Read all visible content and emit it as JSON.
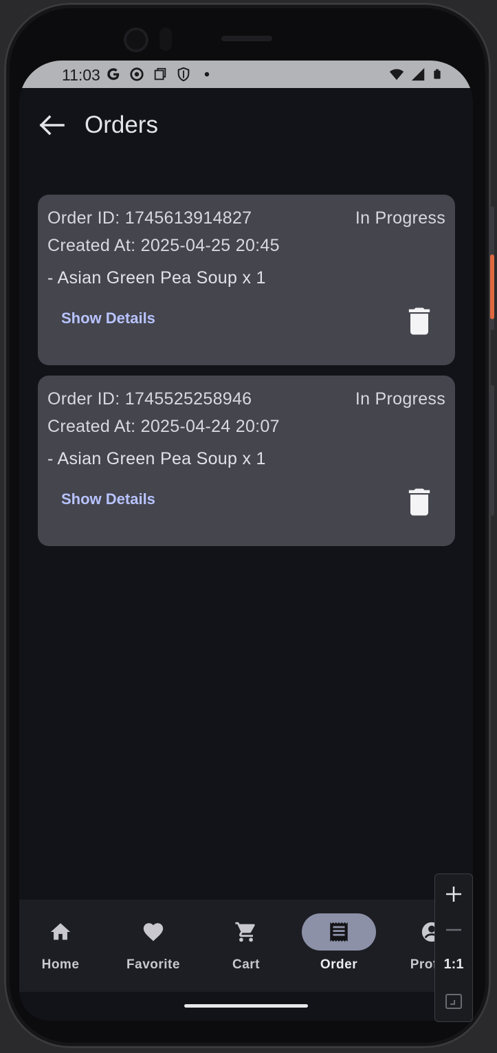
{
  "status_bar": {
    "time": "11:03"
  },
  "app_bar": {
    "title": "Orders"
  },
  "orders": [
    {
      "id_label": "Order ID: 1745613914827",
      "status": "In Progress",
      "created": "Created At: 2025-04-25 20:45",
      "item": "- Asian Green Pea Soup x 1",
      "show_details": "Show Details"
    },
    {
      "id_label": "Order ID: 1745525258946",
      "status": "In Progress",
      "created": "Created At: 2025-04-24 20:07",
      "item": "- Asian Green Pea Soup x 1",
      "show_details": "Show Details"
    }
  ],
  "nav": {
    "items": [
      {
        "label": "Home",
        "icon": "home-icon"
      },
      {
        "label": "Favorite",
        "icon": "heart-icon"
      },
      {
        "label": "Cart",
        "icon": "cart-icon"
      },
      {
        "label": "Order",
        "icon": "receipt-icon",
        "active": true
      },
      {
        "label": "Profile",
        "icon": "account-icon"
      }
    ]
  },
  "zoom": {
    "label": "1:1"
  },
  "colors": {
    "background": "#121318",
    "card": "#44454d",
    "accent_text": "#b8c3ff",
    "active_pill": "#8c91a8",
    "navbar": "#1d1e24"
  }
}
